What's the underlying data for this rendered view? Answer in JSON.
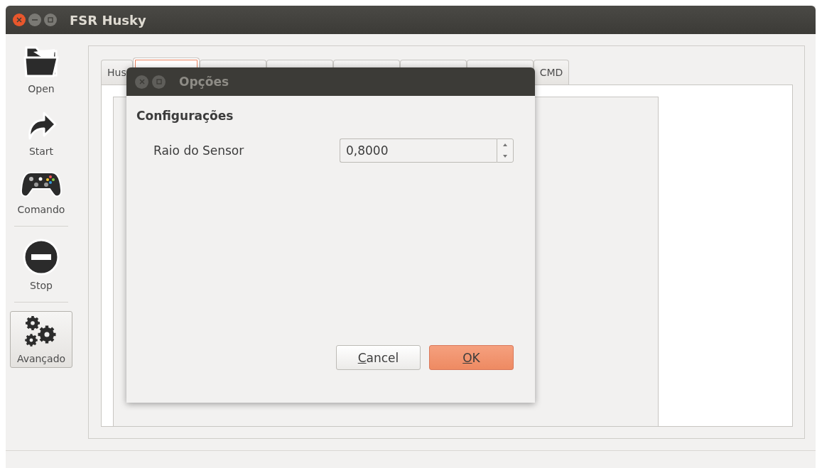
{
  "window": {
    "title": "FSR Husky"
  },
  "toolbar": [
    {
      "kind": "open",
      "label": "Open",
      "selected": false
    },
    {
      "kind": "start",
      "label": "Start",
      "selected": false
    },
    {
      "kind": "gamepad",
      "label": "Comando",
      "selected": false
    },
    {
      "kind": "separator"
    },
    {
      "kind": "stop",
      "label": "Stop",
      "selected": false
    },
    {
      "kind": "separator"
    },
    {
      "kind": "advanced",
      "label": "Avançado",
      "selected": true
    }
  ],
  "tabs": [
    {
      "label": "Hus",
      "selected": false
    },
    {
      "selected": true
    },
    {
      "selected": false
    },
    {
      "selected": false
    },
    {
      "selected": false
    },
    {
      "selected": false
    },
    {
      "selected": false
    },
    {
      "label": "CMD",
      "selected": false
    }
  ],
  "dialog": {
    "title": "Opções",
    "section": "Configurações",
    "fields": [
      {
        "label": "Raio do Sensor",
        "value": "0,8000"
      }
    ],
    "buttons": [
      {
        "label": "Cancel",
        "kind": "normal",
        "mnemonic": true
      },
      {
        "label": "OK",
        "kind": "default",
        "mnemonic": true
      }
    ]
  }
}
